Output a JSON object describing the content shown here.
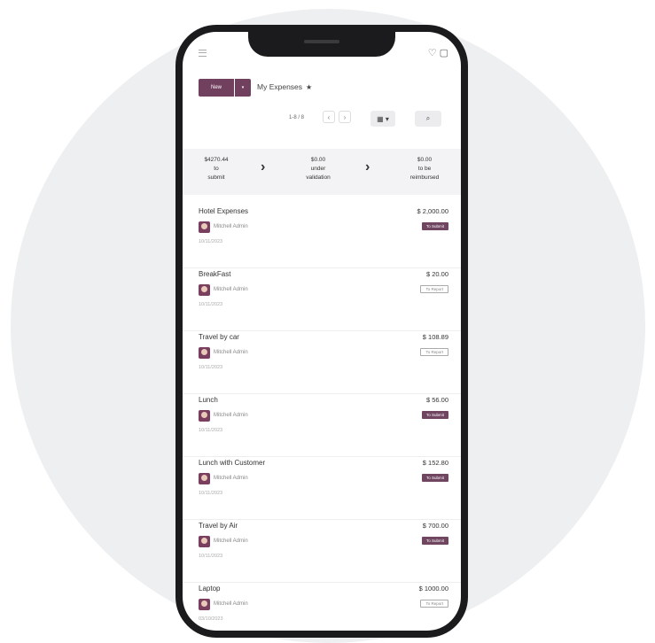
{
  "header": {
    "new_label": "New",
    "caret": "▾",
    "title": "My Expenses",
    "star": "★",
    "status_icons": "♡ ▢"
  },
  "pager": {
    "text": "1-8 / 8",
    "prev": "‹",
    "next": "›",
    "view_label": "▦ ▾",
    "search": "⌕"
  },
  "summary": {
    "stages": [
      {
        "amount": "$4270.44",
        "label1": "to",
        "label2": "submit"
      },
      {
        "amount": "$0.00",
        "label1": "under",
        "label2": "validation"
      },
      {
        "amount": "$0.00",
        "label1": "to be",
        "label2": "reimbursed"
      }
    ],
    "arrow": "›"
  },
  "expenses": [
    {
      "title": "Hotel Expenses",
      "amount": "$ 2,000.00",
      "employee": "Mitchell Admin",
      "date": "10/11/2023",
      "status": "To Submit",
      "style": "dark"
    },
    {
      "title": "BreakFast",
      "amount": "$ 20.00",
      "employee": "Mitchell Admin",
      "date": "10/11/2023",
      "status": "To Report",
      "style": "light"
    },
    {
      "title": "Travel by car",
      "amount": "$ 108.89",
      "employee": "Mitchell Admin",
      "date": "10/11/2023",
      "status": "To Report",
      "style": "light"
    },
    {
      "title": "Lunch",
      "amount": "$ 56.00",
      "employee": "Mitchell Admin",
      "date": "10/11/2023",
      "status": "To Submit",
      "style": "dark"
    },
    {
      "title": "Lunch with Customer",
      "amount": "$ 152.80",
      "employee": "Mitchell Admin",
      "date": "10/11/2023",
      "status": "To Submit",
      "style": "dark"
    },
    {
      "title": "Travel by Air",
      "amount": "$ 700.00",
      "employee": "Mitchell Admin",
      "date": "10/11/2023",
      "status": "To Submit",
      "style": "dark"
    },
    {
      "title": "Laptop",
      "amount": "$ 1000.00",
      "employee": "Mitchell Admin",
      "date": "03/10/2023",
      "status": "To Report",
      "style": "light"
    }
  ]
}
